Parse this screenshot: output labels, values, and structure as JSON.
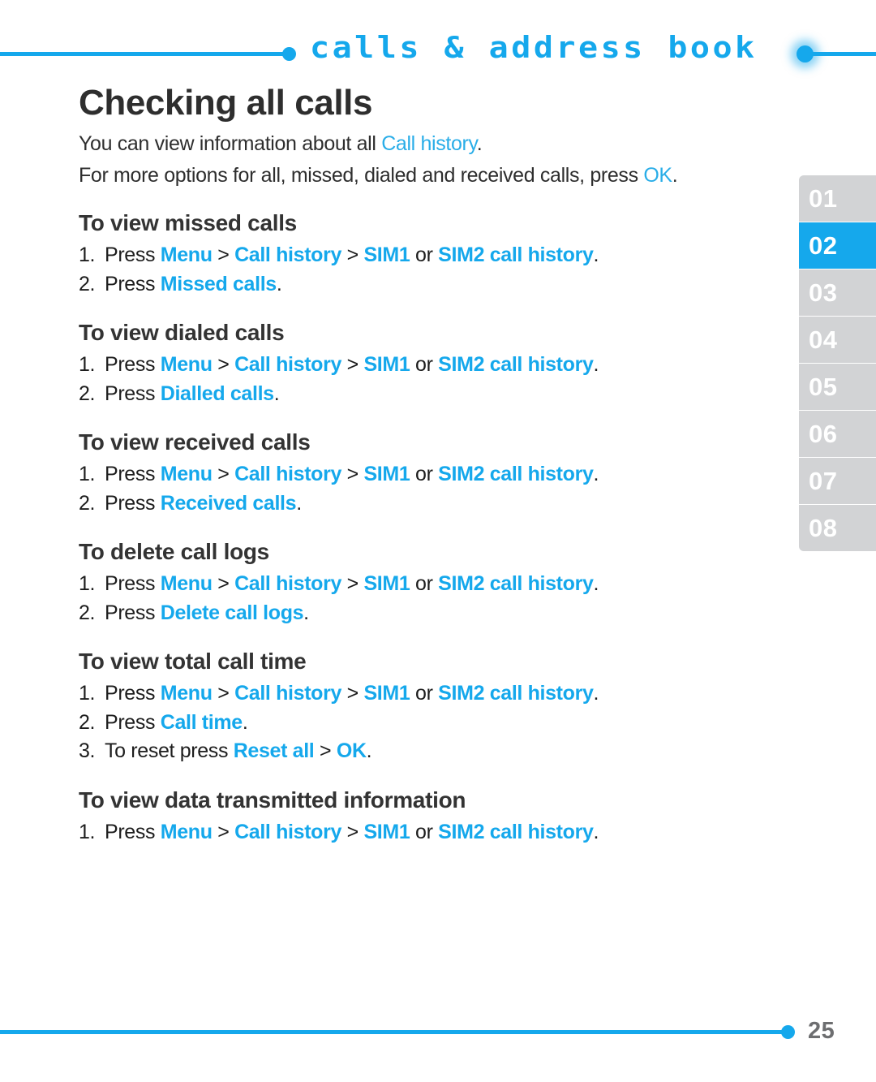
{
  "header": {
    "chapter_title": "calls & address book",
    "accent_color": "#15a8ec"
  },
  "sidebar": {
    "active_tab": "02",
    "tabs": [
      {
        "label": "01",
        "active": false
      },
      {
        "label": "02",
        "active": true
      },
      {
        "label": "03",
        "active": false
      },
      {
        "label": "04",
        "active": false
      },
      {
        "label": "05",
        "active": false
      },
      {
        "label": "06",
        "active": false
      },
      {
        "label": "07",
        "active": false
      },
      {
        "label": "08",
        "active": false
      }
    ]
  },
  "main": {
    "page_title": "Checking all calls",
    "intro": {
      "line1_prefix": "You can view information about all ",
      "line1_link": "Call history",
      "line1_suffix": ".",
      "line2_prefix": "For more options for all, missed, dialed and received calls, press ",
      "line2_link": "OK",
      "line2_suffix": "."
    },
    "sections": [
      {
        "title": "To view missed calls",
        "steps": [
          {
            "number": "1.",
            "parts": [
              {
                "text": "Press ",
                "style": "plain"
              },
              {
                "text": "Menu",
                "style": "hl"
              },
              {
                "text": " > ",
                "style": "sep"
              },
              {
                "text": "Call history",
                "style": "hl"
              },
              {
                "text": " > ",
                "style": "sep"
              },
              {
                "text": "SIM1",
                "style": "hl"
              },
              {
                "text": " or ",
                "style": "sep"
              },
              {
                "text": "SIM2 call history",
                "style": "hl"
              },
              {
                "text": ".",
                "style": "plain"
              }
            ]
          },
          {
            "number": "2.",
            "parts": [
              {
                "text": "Press ",
                "style": "plain"
              },
              {
                "text": "Missed calls",
                "style": "hl"
              },
              {
                "text": ".",
                "style": "plain"
              }
            ]
          }
        ]
      },
      {
        "title": "To view dialed calls",
        "steps": [
          {
            "number": "1.",
            "parts": [
              {
                "text": "Press ",
                "style": "plain"
              },
              {
                "text": "Menu",
                "style": "hl"
              },
              {
                "text": " > ",
                "style": "sep"
              },
              {
                "text": "Call history",
                "style": "hl"
              },
              {
                "text": " > ",
                "style": "sep"
              },
              {
                "text": "SIM1",
                "style": "hl"
              },
              {
                "text": " or ",
                "style": "sep"
              },
              {
                "text": "SIM2 call history",
                "style": "hl"
              },
              {
                "text": ".",
                "style": "plain"
              }
            ]
          },
          {
            "number": "2.",
            "parts": [
              {
                "text": "Press ",
                "style": "plain"
              },
              {
                "text": "Dialled calls",
                "style": "hl"
              },
              {
                "text": ".",
                "style": "plain"
              }
            ]
          }
        ]
      },
      {
        "title": "To view received calls",
        "steps": [
          {
            "number": "1.",
            "parts": [
              {
                "text": "Press ",
                "style": "plain"
              },
              {
                "text": "Menu",
                "style": "hl"
              },
              {
                "text": " > ",
                "style": "sep"
              },
              {
                "text": "Call history",
                "style": "hl"
              },
              {
                "text": " > ",
                "style": "sep"
              },
              {
                "text": "SIM1",
                "style": "hl"
              },
              {
                "text": " or ",
                "style": "sep"
              },
              {
                "text": "SIM2 call history",
                "style": "hl"
              },
              {
                "text": ".",
                "style": "plain"
              }
            ]
          },
          {
            "number": "2.",
            "parts": [
              {
                "text": "Press ",
                "style": "plain"
              },
              {
                "text": "Received calls",
                "style": "hl"
              },
              {
                "text": ".",
                "style": "plain"
              }
            ]
          }
        ]
      },
      {
        "title": "To delete call logs",
        "steps": [
          {
            "number": "1.",
            "parts": [
              {
                "text": "Press ",
                "style": "plain"
              },
              {
                "text": "Menu",
                "style": "hl"
              },
              {
                "text": " > ",
                "style": "sep"
              },
              {
                "text": "Call history",
                "style": "hl"
              },
              {
                "text": " > ",
                "style": "sep"
              },
              {
                "text": "SIM1",
                "style": "hl"
              },
              {
                "text": " or ",
                "style": "sep"
              },
              {
                "text": "SIM2 call history",
                "style": "hl"
              },
              {
                "text": ".",
                "style": "plain"
              }
            ]
          },
          {
            "number": "2.",
            "parts": [
              {
                "text": "Press ",
                "style": "plain"
              },
              {
                "text": "Delete call logs",
                "style": "hl"
              },
              {
                "text": ".",
                "style": "plain"
              }
            ]
          }
        ]
      },
      {
        "title": "To view total call time",
        "steps": [
          {
            "number": "1.",
            "parts": [
              {
                "text": "Press ",
                "style": "plain"
              },
              {
                "text": "Menu",
                "style": "hl"
              },
              {
                "text": " > ",
                "style": "sep"
              },
              {
                "text": "Call history",
                "style": "hl"
              },
              {
                "text": " > ",
                "style": "sep"
              },
              {
                "text": "SIM1",
                "style": "hl"
              },
              {
                "text": " or ",
                "style": "sep"
              },
              {
                "text": "SIM2 call history",
                "style": "hl"
              },
              {
                "text": ".",
                "style": "plain"
              }
            ]
          },
          {
            "number": "2.",
            "parts": [
              {
                "text": "Press ",
                "style": "plain"
              },
              {
                "text": "Call time",
                "style": "hl"
              },
              {
                "text": ".",
                "style": "plain"
              }
            ]
          },
          {
            "number": "3.",
            "parts": [
              {
                "text": "To reset press ",
                "style": "plain"
              },
              {
                "text": "Reset all",
                "style": "hl"
              },
              {
                "text": " > ",
                "style": "sep"
              },
              {
                "text": "OK",
                "style": "hl"
              },
              {
                "text": ".",
                "style": "plain"
              }
            ]
          }
        ]
      },
      {
        "title": "To view data transmitted information",
        "steps": [
          {
            "number": "1.",
            "parts": [
              {
                "text": "Press ",
                "style": "plain"
              },
              {
                "text": "Menu",
                "style": "hl"
              },
              {
                "text": " > ",
                "style": "sep"
              },
              {
                "text": "Call history",
                "style": "hl"
              },
              {
                "text": " > ",
                "style": "sep"
              },
              {
                "text": "SIM1",
                "style": "hl"
              },
              {
                "text": " or ",
                "style": "sep"
              },
              {
                "text": "SIM2 call history",
                "style": "hl"
              },
              {
                "text": ".",
                "style": "plain"
              }
            ]
          }
        ]
      }
    ]
  },
  "footer": {
    "page_number": "25"
  }
}
